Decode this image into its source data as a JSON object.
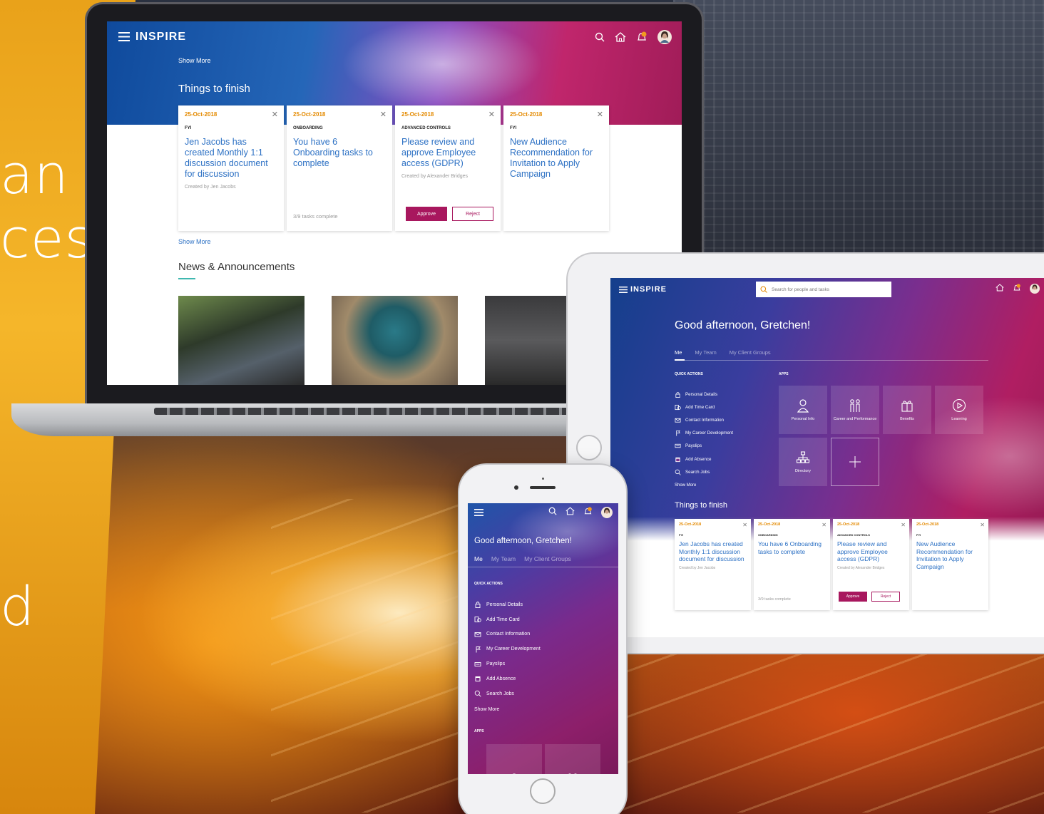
{
  "background": {
    "left_text_lines": [
      "an",
      "ces",
      "d"
    ]
  },
  "brand": {
    "logo": "INSPIRE",
    "accent": "#a8175e",
    "link_color": "#2d71c4",
    "date_color": "#e48a00"
  },
  "laptop": {
    "show_more_top": "Show More",
    "things_title": "Things to finish",
    "cards": [
      {
        "date": "25-Oct-2018",
        "type": "FYI",
        "message": "Jen Jacobs has created Monthly 1:1 discussion document for discussion",
        "by": "Created by Jen Jacobs"
      },
      {
        "date": "25-Oct-2018",
        "type": "ONBOARDING",
        "message": "You have 6 Onboarding tasks to complete",
        "progress": "3/9 tasks complete"
      },
      {
        "date": "25-Oct-2018",
        "type": "ADVANCED CONTROLS",
        "message": "Please review and approve Employee access (GDPR)",
        "by": "Created by Alexander Bridges",
        "approve": "Approve",
        "reject": "Reject"
      },
      {
        "date": "25-Oct-2018",
        "type": "FYI",
        "message": "New Audience Recommendation for Invitation to Apply Campaign"
      }
    ],
    "show_more": "Show More",
    "news_title": "News & Announcements"
  },
  "tablet": {
    "search_placeholder": "Search for people and tasks",
    "greeting": "Good afternoon, Gretchen!",
    "tabs": [
      "Me",
      "My Team",
      "My Client Groups"
    ],
    "quick_actions_title": "QUICK ACTIONS",
    "apps_title": "APPS",
    "quick_actions": [
      "Personal Details",
      "Add Time Card",
      "Contact Information",
      "My Career Development",
      "Payslips",
      "Add Absence",
      "Search Jobs"
    ],
    "show_more": "Show More",
    "apps": [
      "Personal Info",
      "Career and Performance",
      "Benefits",
      "Learning",
      "Directory"
    ],
    "things_title": "Things to finish",
    "cards": [
      {
        "date": "25-Oct-2018",
        "type": "FYI",
        "message": "Jen Jacobs has created Monthly 1:1 discussion document for discussion",
        "by": "Created by Jen Jacobs"
      },
      {
        "date": "25-Oct-2018",
        "type": "ONBOARDING",
        "message": "You have 6 Onboarding tasks to complete",
        "progress": "3/9 tasks complete"
      },
      {
        "date": "25-Oct-2018",
        "type": "ADVANCED CONTROLS",
        "message": "Please review and approve Employee access (GDPR)",
        "by": "Created by Alexander Bridges",
        "approve": "Approve",
        "reject": "Reject"
      },
      {
        "date": "25-Oct-2018",
        "type": "FYI",
        "message": "New Audience Recommendation for Invitation to Apply Campaign"
      }
    ]
  },
  "phone": {
    "greeting": "Good afternoon, Gretchen!",
    "tabs": [
      "Me",
      "My Team",
      "My Client Groups"
    ],
    "quick_actions_title": "QUICK ACTIONS",
    "quick_actions": [
      "Personal Details",
      "Add Time Card",
      "Contact Information",
      "My Career Development",
      "Payslips",
      "Add Absence",
      "Search Jobs"
    ],
    "show_more": "Show More",
    "apps_title": "APPS"
  }
}
